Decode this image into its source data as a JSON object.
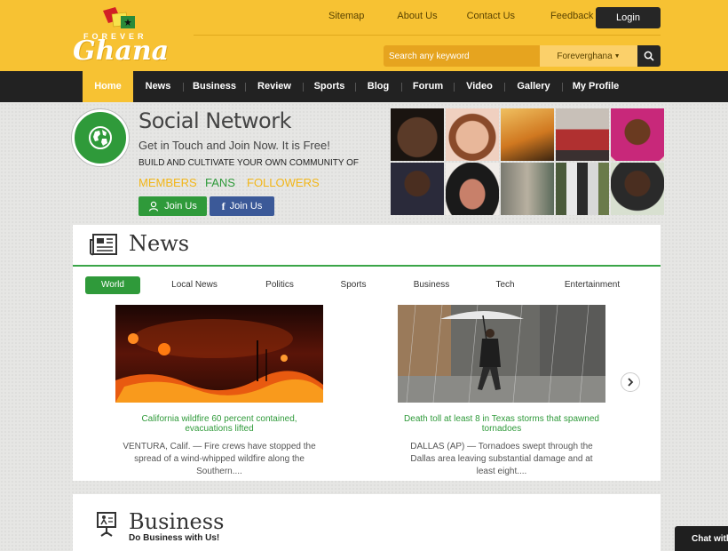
{
  "brand": {
    "top_word": "FOREVER",
    "name": "Ghana",
    "accent_color": "#f7c233",
    "green_color": "#2f9a3a"
  },
  "top_links": [
    "Sitemap",
    "About Us",
    "Contact Us",
    "Feedback"
  ],
  "login_label": "Login",
  "search": {
    "placeholder": "Search any keyword",
    "site_select": "Foreverghana"
  },
  "nav": [
    "Home",
    "News",
    "Business",
    "Review",
    "Sports",
    "Blog",
    "Forum",
    "Video",
    "Gallery",
    "My Profile"
  ],
  "nav_active": "Home",
  "social": {
    "title": "Social Network",
    "subtitle": "Get in Touch and Join Now. It is Free!",
    "build_line": "BUILD AND CULTIVATE YOUR OWN COMMUNITY OF",
    "tags": [
      "MEMBERS",
      "FANS",
      "FOLLOWERS"
    ],
    "join_label": "Join Us",
    "fb_join_label": "Join Us"
  },
  "news": {
    "title": "News",
    "tabs": [
      "World",
      "Local News",
      "Politics",
      "Sports",
      "Business",
      "Tech",
      "Entertainment"
    ],
    "active_tab": "World",
    "stories": [
      {
        "headline": "California wildfire 60 percent contained, evacuations lifted",
        "body": "VENTURA, Calif. — Fire crews have stopped the spread of a wind-whipped wildfire along the Southern...."
      },
      {
        "headline": "Death toll at least 8 in Texas storms that spawned tornadoes",
        "body": "DALLAS (AP) — Tornadoes swept through the Dallas area leaving substantial damage and at least eight...."
      }
    ]
  },
  "business": {
    "title": "Business",
    "subtitle": "Do Business with Us!"
  },
  "chat_label": "Chat with"
}
